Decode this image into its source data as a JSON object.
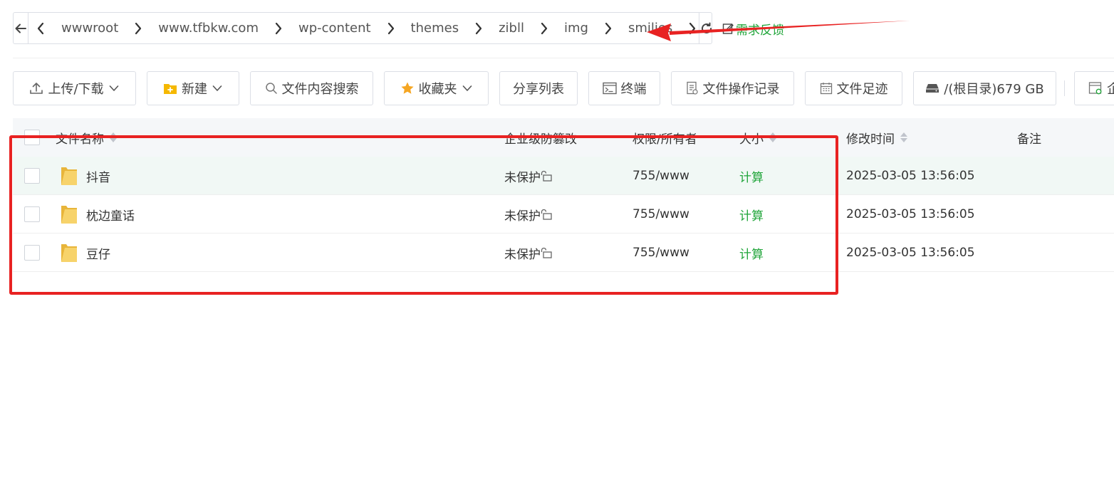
{
  "path_bar": {
    "crumbs": [
      "wwwroot",
      "www.tfbkw.com",
      "wp-content",
      "themes",
      "zibll",
      "img",
      "smilies"
    ],
    "feedback_label": "需求反馈"
  },
  "toolbar": {
    "upload_download": "上传/下载",
    "new": "新建",
    "content_search": "文件内容搜索",
    "favorites": "收藏夹",
    "share_list": "分享列表",
    "terminal": "终端",
    "op_log": "文件操作记录",
    "footprint": "文件足迹",
    "disk": "/(根目录)679 GB",
    "partial": "企"
  },
  "table": {
    "columns": {
      "name": "文件名称",
      "tamper": "企业级防篡改",
      "perm": "权限/所有者",
      "size": "大小",
      "mtime": "修改时间",
      "note": "备注"
    },
    "rows": [
      {
        "name": "抖音",
        "tamper": "未保护",
        "perm": "755/www",
        "size": "计算",
        "mtime": "2025-03-05 13:56:05",
        "note": ""
      },
      {
        "name": "枕边童话",
        "tamper": "未保护",
        "perm": "755/www",
        "size": "计算",
        "mtime": "2025-03-05 13:56:05",
        "note": ""
      },
      {
        "name": "豆仔",
        "tamper": "未保护",
        "perm": "755/www",
        "size": "计算",
        "mtime": "2025-03-05 13:56:05",
        "note": ""
      }
    ]
  },
  "colors": {
    "accent": "#20a53a",
    "annotation_red": "#e82222",
    "row_hover": "#f1f8f5",
    "folder": "#f7c948"
  },
  "icons": [
    "back-arrow-icon",
    "chevron-right-icon",
    "refresh-icon",
    "edit-icon",
    "upload-icon",
    "new-folder-icon",
    "search-icon",
    "star-icon",
    "terminal-icon",
    "log-icon",
    "calendar-icon",
    "disk-icon",
    "folder-icon",
    "unlock-icon",
    "sort-icon"
  ]
}
